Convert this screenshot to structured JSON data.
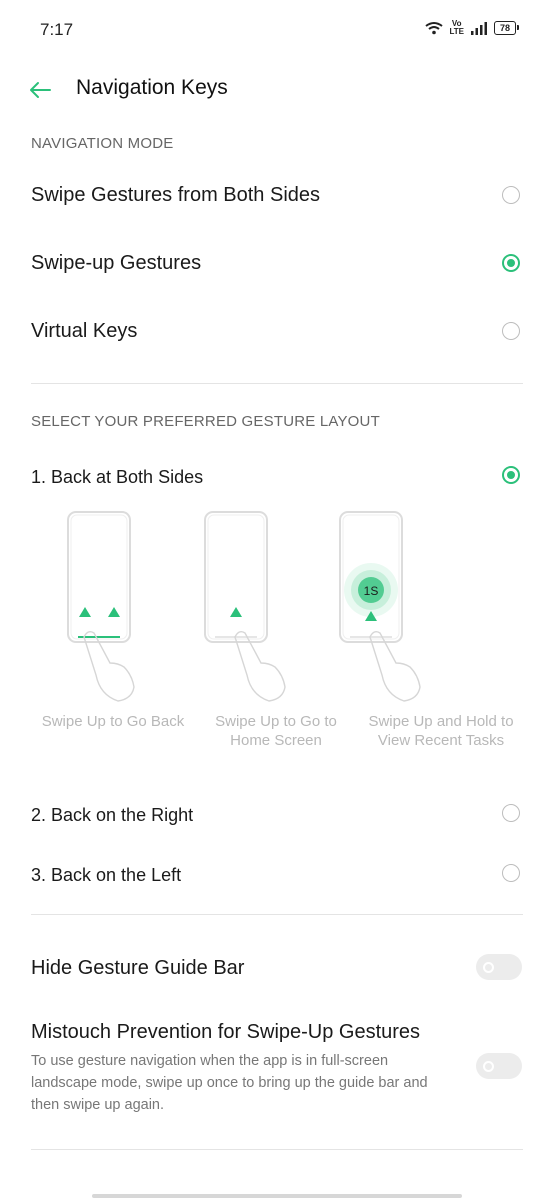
{
  "status_bar": {
    "time": "7:17",
    "volte_top": "Vo",
    "volte_bottom": "LTE",
    "battery": "78"
  },
  "header": {
    "title": "Navigation Keys"
  },
  "navigation_mode": {
    "section_title": "NAVIGATION MODE",
    "options": [
      {
        "label": "Swipe Gestures from Both Sides",
        "selected": false
      },
      {
        "label": "Swipe-up Gestures",
        "selected": true
      },
      {
        "label": "Virtual Keys",
        "selected": false
      }
    ]
  },
  "gesture_layout": {
    "section_title": "SELECT YOUR PREFERRED GESTURE LAYOUT",
    "options": [
      {
        "label": "1. Back at Both Sides",
        "selected": true
      },
      {
        "label": "2. Back on the Right",
        "selected": false
      },
      {
        "label": "3. Back on the Left",
        "selected": false
      }
    ],
    "illustrations": [
      {
        "caption_line1": "Swipe Up to Go Back",
        "caption_line2": ""
      },
      {
        "caption_line1": "Swipe Up to Go to",
        "caption_line2": "Home Screen"
      },
      {
        "caption_line1": "Swipe Up and Hold to",
        "caption_line2": "View Recent Tasks"
      }
    ],
    "hold_label": "1S"
  },
  "settings": {
    "hide_guide_bar": {
      "title": "Hide Gesture Guide Bar",
      "enabled": false
    },
    "mistouch": {
      "title": "Mistouch Prevention for Swipe-Up Gestures",
      "description": "To use gesture navigation when the app is in full-screen landscape mode, swipe up once to bring up the guide bar and then swipe up again.",
      "enabled": false
    }
  },
  "colors": {
    "accent": "#2bc07a",
    "divider": "#e4e4e4",
    "toggle_off": "#ececec"
  }
}
